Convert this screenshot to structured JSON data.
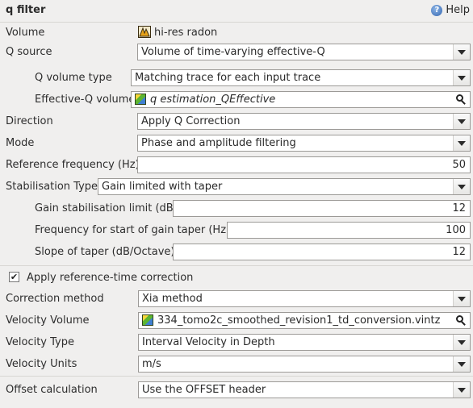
{
  "header": {
    "title": "q filter",
    "help_label": "Help",
    "help_icon": "help-icon"
  },
  "volume": {
    "label": "Volume",
    "value": "hi-res radon",
    "icon": "hi-res-volume-icon"
  },
  "q_source": {
    "label": "Q source",
    "value": "Volume of time-varying effective-Q"
  },
  "q_volume_type": {
    "label": "Q volume type",
    "value": "Matching trace for each input trace"
  },
  "effective_q_volume": {
    "label": "Effective-Q volume",
    "value": "q estimation_QEffective",
    "icon": "volume-cube-icon"
  },
  "direction": {
    "label": "Direction",
    "value": "Apply Q Correction"
  },
  "mode": {
    "label": "Mode",
    "value": "Phase and amplitude filtering"
  },
  "reference_frequency": {
    "label": "Reference frequency (Hz)",
    "value": "50"
  },
  "stabilisation_type": {
    "label": "Stabilisation Type",
    "value": "Gain limited with taper"
  },
  "gain_limit": {
    "label": "Gain stabilisation limit (dB)",
    "value": "12"
  },
  "taper_start": {
    "label": "Frequency for start of gain taper (Hz)",
    "value": "100"
  },
  "taper_slope": {
    "label": "Slope of taper (dB/Octave)",
    "value": "12"
  },
  "apply_reference_time": {
    "label": "Apply reference-time correction",
    "checked": true,
    "check_glyph": "✔"
  },
  "correction_method": {
    "label": "Correction method",
    "value": "Xia method"
  },
  "velocity_volume": {
    "label": "Velocity Volume",
    "value": "334_tomo2c_smoothed_revision1_td_conversion.vintz",
    "icon": "volume-cube-icon"
  },
  "velocity_type": {
    "label": "Velocity Type",
    "value": "Interval Velocity in Depth"
  },
  "velocity_units": {
    "label": "Velocity Units",
    "value": "m/s"
  },
  "offset_calculation": {
    "label": "Offset calculation",
    "value": "Use the OFFSET header"
  }
}
